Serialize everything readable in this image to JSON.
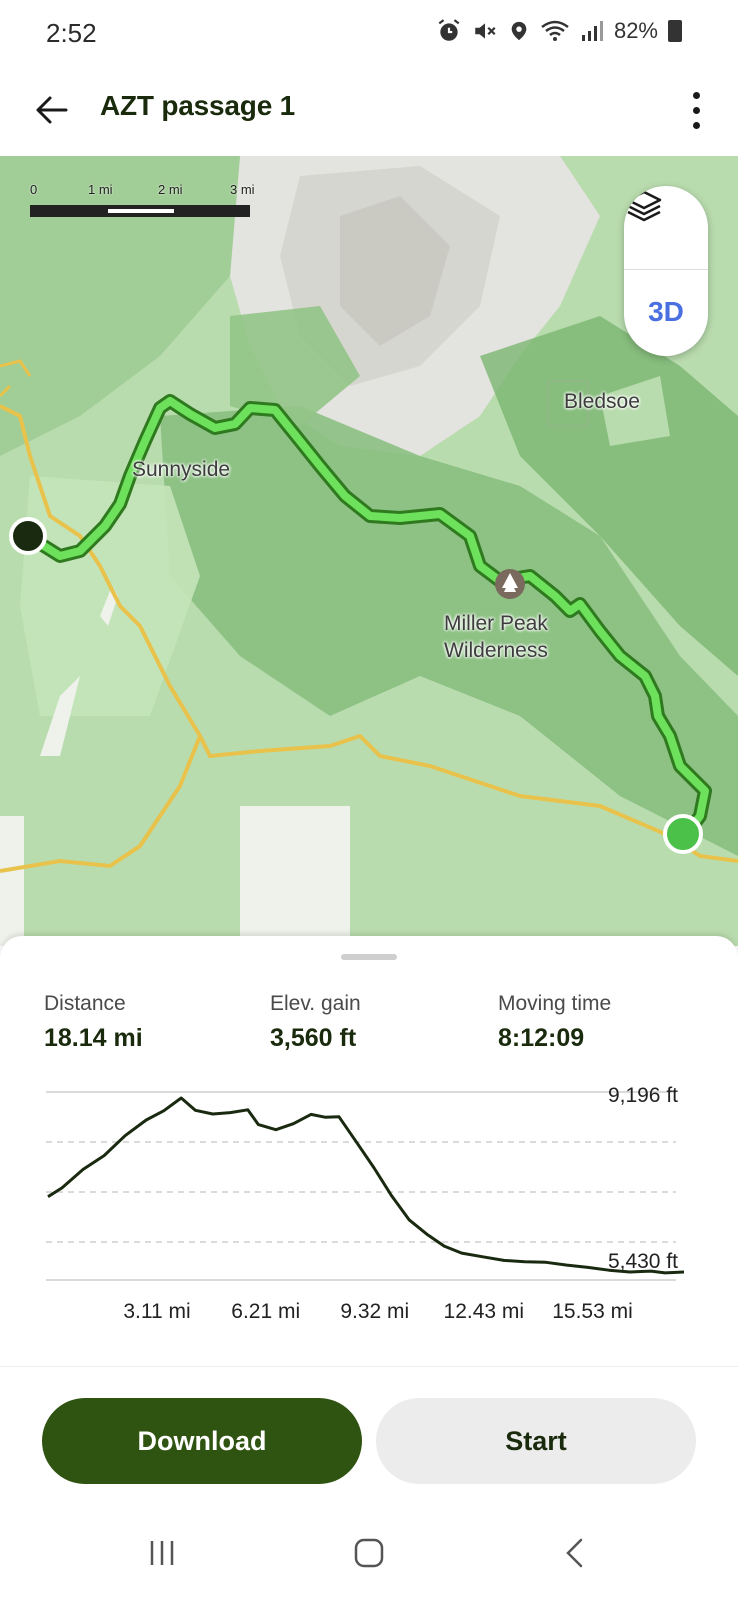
{
  "status_bar": {
    "time": "2:52",
    "battery": "82%",
    "icons": [
      "alarm-icon",
      "mute-icon",
      "location-icon",
      "wifi-icon",
      "signal-icon",
      "battery-icon"
    ]
  },
  "header": {
    "title": "AZT passage 1",
    "back_icon": "arrow-left-icon",
    "menu_icon": "more-vertical-icon"
  },
  "map": {
    "scale": {
      "labels": [
        "0",
        "1 mi",
        "2 mi",
        "3 mi"
      ]
    },
    "labels": {
      "sunnyside": "Sunnyside",
      "bledsoe": "Bledsoe",
      "miller_peak": "Miller Peak\nWilderness"
    },
    "controls": {
      "layers_icon": "layers-icon",
      "view_3d": "3D"
    },
    "colors": {
      "route": "#66d957",
      "route_outline": "#2f7a1f",
      "start_marker": "#1a2a10",
      "end_marker": "#4cc14a",
      "road": "#e8c24a"
    }
  },
  "stats": {
    "distance": {
      "label": "Distance",
      "value": "18.14 mi"
    },
    "elev_gain": {
      "label": "Elev. gain",
      "value": "3,560 ft"
    },
    "moving_time": {
      "label": "Moving time",
      "value": "8:12:09"
    }
  },
  "chart_data": {
    "type": "line",
    "title": "",
    "xlabel": "",
    "ylabel": "",
    "x_ticks": [
      "3.11 mi",
      "6.21 mi",
      "9.32 mi",
      "12.43 mi",
      "15.53 mi"
    ],
    "y_labels": {
      "max": "9,196 ft",
      "min": "5,430 ft"
    },
    "xlim": [
      0,
      18.14
    ],
    "ylim": [
      5430,
      9196
    ],
    "series": [
      {
        "x": [
          0,
          0.4,
          1.0,
          1.6,
          2.2,
          2.8,
          3.3,
          3.8,
          4.2,
          4.7,
          5.2,
          5.7,
          6.0,
          6.5,
          7.0,
          7.5,
          7.9,
          8.3,
          8.8,
          9.3,
          9.8,
          10.3,
          10.8,
          11.3,
          11.8,
          12.4,
          13.0,
          13.6,
          14.2,
          14.8,
          15.4,
          16.0,
          16.6,
          17.2,
          17.6,
          18.14
        ],
        "y": [
          7060,
          7250,
          7650,
          7950,
          8380,
          8720,
          8920,
          9196,
          8930,
          8850,
          8880,
          8940,
          8620,
          8510,
          8640,
          8840,
          8780,
          8790,
          8240,
          7680,
          7080,
          6560,
          6250,
          5990,
          5840,
          5760,
          5680,
          5650,
          5640,
          5580,
          5530,
          5470,
          5430,
          5450,
          5410,
          5430
        ]
      }
    ],
    "grid": true,
    "color": "#1a2a10"
  },
  "actions": {
    "download": "Download",
    "start": "Start"
  },
  "navbar": {
    "recents_icon": "recents-icon",
    "home_icon": "home-icon",
    "back_icon": "back-chevron-icon"
  }
}
